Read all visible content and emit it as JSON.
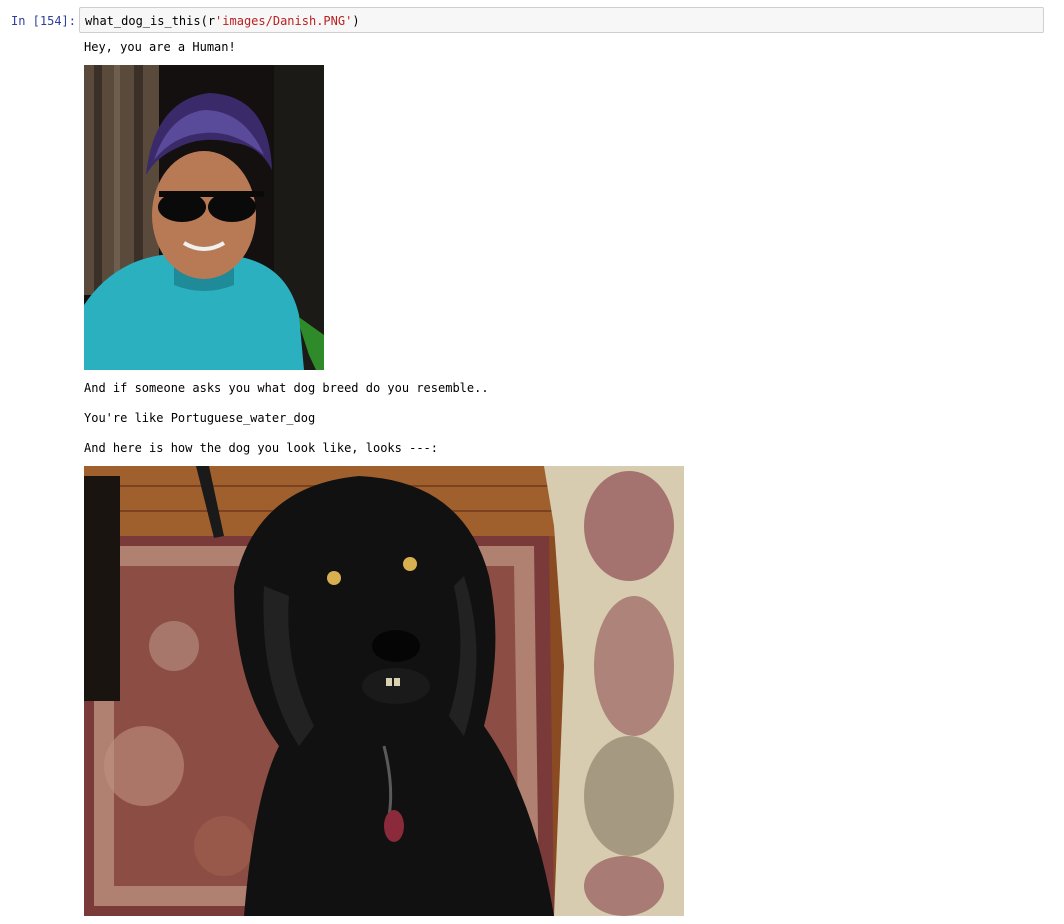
{
  "cell": {
    "prompt": "In [154]:",
    "code": {
      "func": "what_dog_is_this(r",
      "str": "'images/Danish.PNG'",
      "close": ")"
    }
  },
  "output": {
    "line1": "Hey, you are a Human!",
    "line2": "And if someone asks you what dog breed do you resemble..",
    "line3": "You're like Portuguese_water_dog",
    "line4": "And here is how the dog you look like, looks ---:"
  },
  "images": {
    "human_photo": "person-photo",
    "dog_photo": "dog-photo"
  }
}
